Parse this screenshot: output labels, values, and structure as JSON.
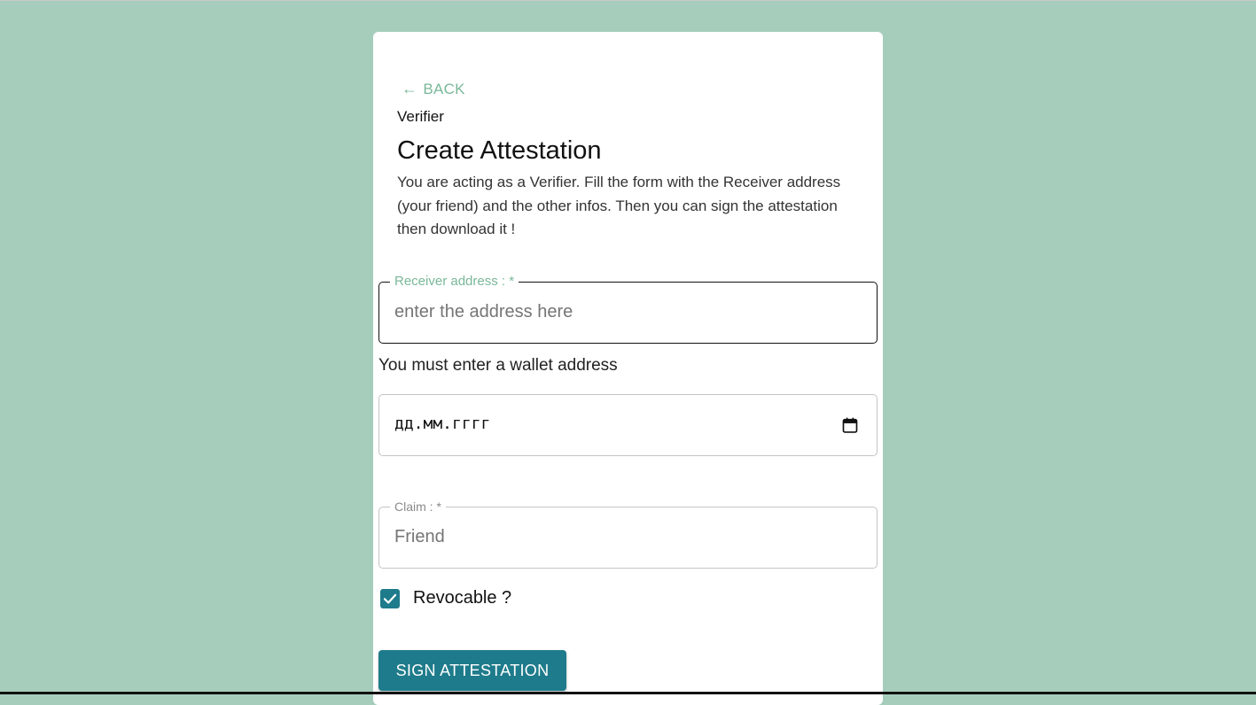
{
  "page": {
    "back_label": "BACK",
    "role": "Verifier",
    "title": "Create Attestation",
    "description": "You are acting as a Verifier. Fill the form with the Receiver address (your friend) and the other infos. Then you can sign the attestation then download it !"
  },
  "form": {
    "receiver": {
      "label": "Receiver address : *",
      "placeholder": "enter the address here",
      "value": ""
    },
    "receiver_error": "You must enter a wallet address",
    "date": {
      "placeholder": "дд.мм.гггг"
    },
    "claim": {
      "label": "Claim :  *",
      "placeholder": "Friend",
      "value": ""
    },
    "revocable": {
      "label": "Revocable ?",
      "checked": true
    },
    "submit_label": "SIGN ATTESTATION"
  },
  "colors": {
    "background": "#a6cdbc",
    "accent": "#7ab89a",
    "primary": "#1e7b8b",
    "card": "#ffffff"
  },
  "icons": {
    "back": "arrow-left-icon",
    "calendar": "calendar-icon",
    "checkbox": "checkmark-icon"
  }
}
